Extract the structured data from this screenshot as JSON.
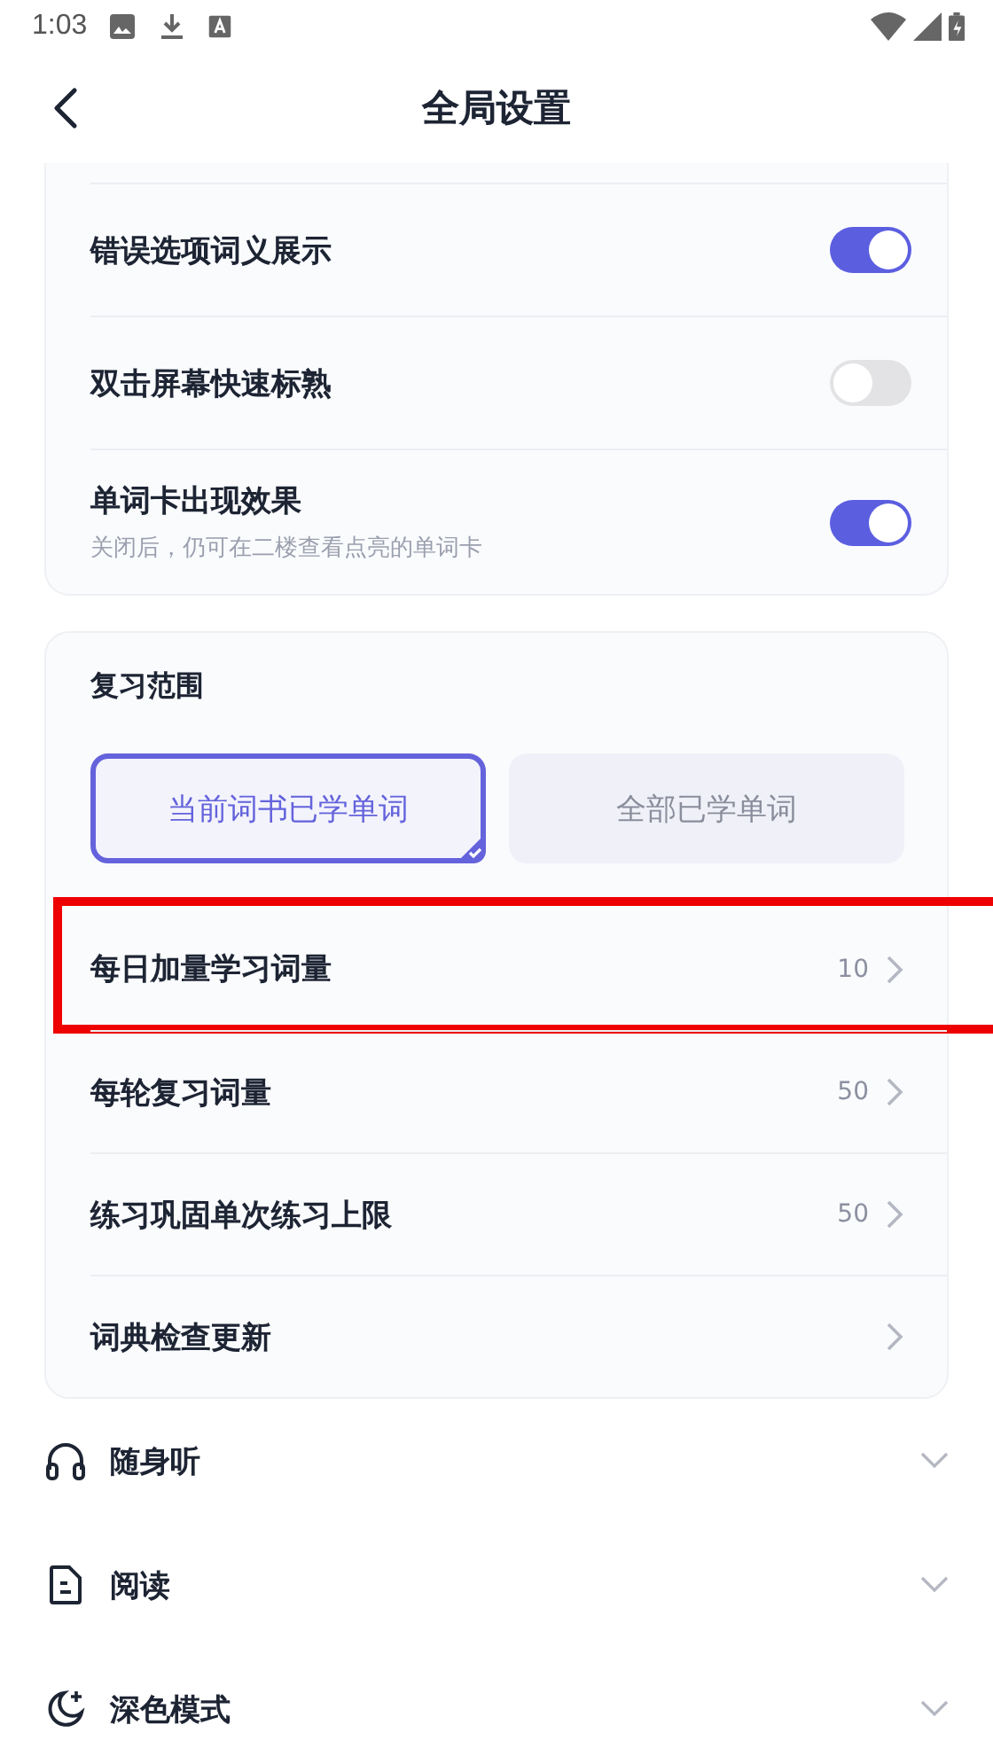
{
  "status_bar": {
    "time": "1:03"
  },
  "header": {
    "title": "全局设置"
  },
  "toggles": [
    {
      "label": "错误选项词义展示",
      "on": true
    },
    {
      "label": "双击屏幕快速标熟",
      "on": false
    },
    {
      "label": "单词卡出现效果",
      "subtitle": "关闭后，仍可在二楼查看点亮的单词卡",
      "on": true
    }
  ],
  "review": {
    "title": "复习范围",
    "options": [
      {
        "label": "当前词书已学单词",
        "selected": true
      },
      {
        "label": "全部已学单词",
        "selected": false
      }
    ],
    "rows": [
      {
        "label": "每日加量学习词量",
        "value": "10",
        "highlighted": true
      },
      {
        "label": "每轮复习词量",
        "value": "50",
        "highlighted": false
      },
      {
        "label": "练习巩固单次练习上限",
        "value": "50",
        "highlighted": false
      },
      {
        "label": "词典检查更新",
        "highlighted": false
      }
    ]
  },
  "sections": [
    {
      "kind": "headphones",
      "label": "随身听",
      "expanded": false
    },
    {
      "kind": "document",
      "label": "阅读",
      "expanded": false
    },
    {
      "kind": "moon",
      "label": "深色模式",
      "expanded": false
    }
  ]
}
